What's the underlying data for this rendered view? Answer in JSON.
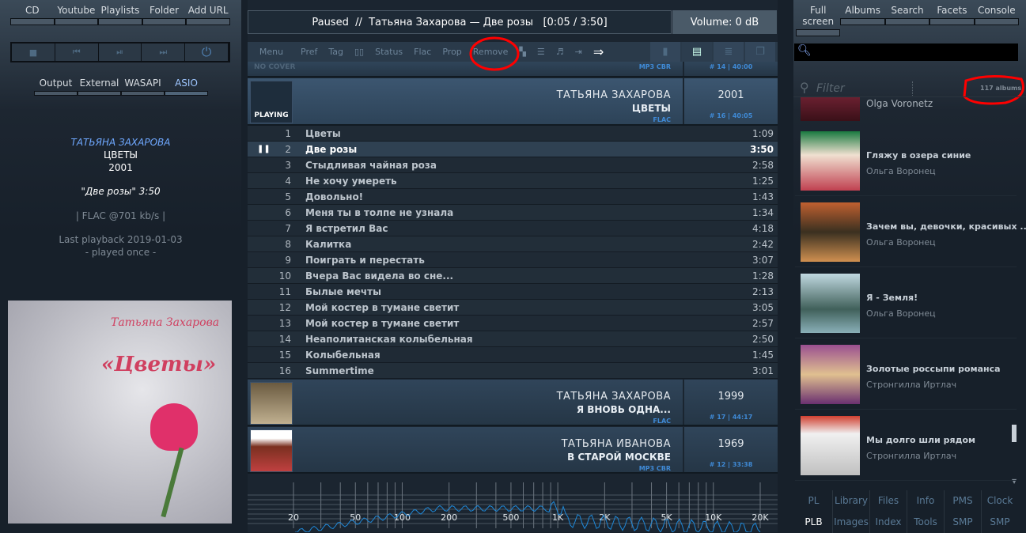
{
  "left": {
    "source_tabs": [
      "CD",
      "Youtube",
      "Playlists",
      "Folder",
      "Add URL"
    ],
    "controls": [
      {
        "icon": "stop-icon",
        "glyph": "■"
      },
      {
        "icon": "previous-icon",
        "glyph": "⏮"
      },
      {
        "icon": "play-pause-icon",
        "glyph": "⏯"
      },
      {
        "icon": "next-icon",
        "glyph": "⏭"
      },
      {
        "icon": "power-icon",
        "glyph": "⏻"
      }
    ],
    "output_tabs": [
      "Output",
      "External",
      "WASAPI",
      "ASIO"
    ],
    "active_output": "ASIO",
    "now": {
      "artist": "ТАТЬЯНА ЗАХАРОВА",
      "album": "ЦВЕТЫ",
      "year": "2001",
      "track": "\"Две розы\" 3:50",
      "codec": "| FLAC @701 kb/s |",
      "last_playback": "Last playback 2019-01-03",
      "play_count": "- played once -"
    },
    "cover": {
      "artist": "Татьяна Захарова",
      "title": "«Цветы»"
    }
  },
  "center": {
    "status": "Paused  //  Татьяна Захарова — Две розы   [0:05 / 3:50]",
    "volume": "Volume: 0 dB",
    "toolbar": [
      "Menu",
      "Pref",
      "Tag",
      "▯▯",
      "Status",
      "Flac",
      "Prop",
      "Remove"
    ],
    "prev_album": {
      "cover": "NO COVER",
      "format": "MP3 CBR",
      "info": "# 14  | 40:00"
    },
    "album": {
      "artist": "ТАТЬЯНА ЗАХАРОВА",
      "name": "ЦВЕТЫ",
      "format": "FLAC",
      "year": "2001",
      "info": "# 16  | 40:05",
      "badge": "PLAYING"
    },
    "tracks": [
      [
        "1",
        "Цветы",
        "1:09"
      ],
      [
        "2",
        "Две розы",
        "3:50"
      ],
      [
        "3",
        "Стыдливая чайная роза",
        "2:58"
      ],
      [
        "4",
        "Не хочу умереть",
        "1:25"
      ],
      [
        "5",
        "Довольно!",
        "1:43"
      ],
      [
        "6",
        "Меня ты в толпе не узнала",
        "1:34"
      ],
      [
        "7",
        "Я встретил Вас",
        "4:18"
      ],
      [
        "8",
        "Калитка",
        "2:42"
      ],
      [
        "9",
        "Поиграть и перестать",
        "3:07"
      ],
      [
        "10",
        "Вчера Вас видела во сне...",
        "1:28"
      ],
      [
        "11",
        "Былые мечты",
        "2:13"
      ],
      [
        "12",
        "Мой костер в тумане светит",
        "3:05"
      ],
      [
        "13",
        "Мой костер в тумане светит",
        "2:57"
      ],
      [
        "14",
        "Неаполитанская колыбельная",
        "2:50"
      ],
      [
        "15",
        "Колыбельная",
        "1:45"
      ],
      [
        "16",
        "Summertime",
        "3:01"
      ]
    ],
    "current_track": 2,
    "next_albums": [
      {
        "artist": "ТАТЬЯНА  ЗАХАРОВА",
        "name": "Я  ВНОВЬ  ОДНА...",
        "format": "FLAC",
        "year": "1999",
        "info": "# 17  | 44:17"
      },
      {
        "artist": "ТАТЬЯНА ИВАНОВА",
        "name": "В СТАРОЙ МОСКВЕ",
        "format": "MP3 CBR",
        "year": "1969",
        "info": "# 12  | 33:38"
      }
    ],
    "spectrum_labels": [
      "20",
      "50",
      "100",
      "200",
      "500",
      "1K",
      "2K",
      "5K",
      "10K",
      "20K"
    ]
  },
  "right": {
    "tabs": [
      "Full screen",
      "Albums",
      "Search",
      "Facets",
      "Console"
    ],
    "filter_placeholder": "Filter",
    "album_count": "117 albums",
    "albums": [
      {
        "title": "",
        "artist": "Olga Voronetz"
      },
      {
        "title": "Гляжу в озера синие",
        "artist": "Ольга Воронец"
      },
      {
        "title": "Зачем вы, девочки, красивых ...",
        "artist": "Ольга Воронец"
      },
      {
        "title": "Я - Земля!",
        "artist": "Ольга Воронец"
      },
      {
        "title": "Золотые россыпи романса",
        "artist": "Стронгилла Иртлач"
      },
      {
        "title": "Мы долго шли рядом",
        "artist": "Стронгилла Иртлач"
      }
    ],
    "nav": [
      [
        "PL",
        "PLB"
      ],
      [
        "Library",
        "Images"
      ],
      [
        "Files",
        "Index"
      ],
      [
        "Info",
        "Tools"
      ],
      [
        "PMS",
        "SMP"
      ],
      [
        "Clock",
        "SMP"
      ]
    ],
    "active_nav": "PLB"
  },
  "colors": {
    "accent": "#3f8ad6",
    "annotation": "#ff0000"
  }
}
